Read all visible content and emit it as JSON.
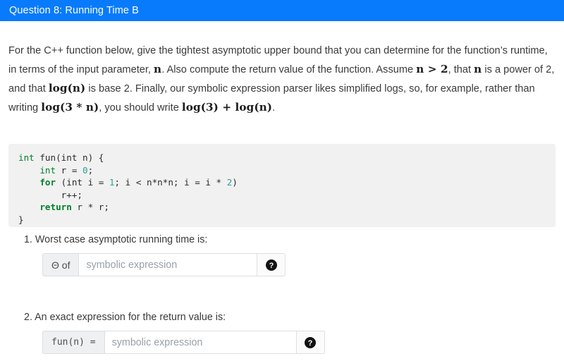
{
  "header": {
    "title": "Question 8: Running Time B",
    "background_color": "#077bfb",
    "text_color": "#ffffff"
  },
  "prompt": {
    "part1": "For the C++ function below, give the tightest asymptotic upper bound that you can determine for the function’s runtime, in terms of the input parameter, ",
    "math_n1": "n",
    "part2": ". Also compute the return value of the function. Assume ",
    "math_ngt2": "n > 2",
    "part3": ", that ",
    "math_n2": "n",
    "part4": " is a power of 2, and that ",
    "math_logn": "log(n)",
    "part5": " is base 2. Finally, our symbolic expression parser likes simplified logs, so, for example, rather than writing ",
    "math_log3n": "log(3 * n)",
    "part6": ", you should write ",
    "math_log3logn": "log(3) + log(n)",
    "part7": "."
  },
  "code": {
    "language": "cpp",
    "background_color": "#f1f1f1",
    "lines": [
      "int fun(int n) {",
      "    int r = 0;",
      "    for (int i = 1; i < n*n*n; i = i * 2)",
      "        r++;",
      "    return r * r;",
      "}"
    ],
    "tokens": {
      "keyword_color": "#00802b",
      "number_color": "#2aa198",
      "text_color": "#2b2b2b"
    },
    "l1_t1": "int",
    "l1_t2": " fun(int n) {",
    "l2_t1": "    int",
    "l2_t2": " r = ",
    "l2_t3": "0",
    "l2_t4": ";",
    "l3_t1": "    for",
    "l3_t2": " (int i = ",
    "l3_t3": "1",
    "l3_t4": "; i < n*n*n; i = i * ",
    "l3_t5": "2",
    "l3_t6": ")",
    "l4_t1": "        r++;",
    "l5_t1": "    return",
    "l5_t2": " r * r;",
    "l6_t1": "}"
  },
  "questions": [
    {
      "label": "1. Worst case asymptotic running time is:",
      "prefix": "Θ of",
      "value": "",
      "placeholder": "symbolic expression",
      "help_icon": "question-mark-circle-icon"
    },
    {
      "label": "2. An exact expression for the return value is:",
      "prefix": "fun(n) =",
      "value": "",
      "placeholder": "symbolic expression",
      "help_icon": "question-mark-circle-icon"
    }
  ]
}
